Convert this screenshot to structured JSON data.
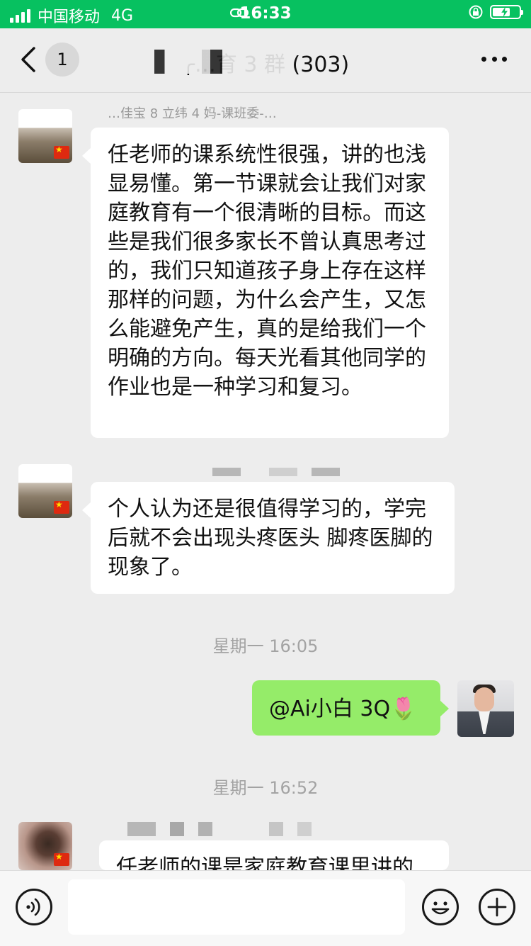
{
  "status_bar": {
    "carrier": "中国移动",
    "network": "4G",
    "time": "16:33"
  },
  "nav": {
    "unread_count": "1",
    "title": "╭…育 3 群 (303)"
  },
  "messages": [
    {
      "side": "left",
      "sender": "…佳宝 8 立纬 4 妈-课班委-…",
      "text": "任老师的课系统性很强，讲的也浅显易懂。第一节课就会让我们对家庭教育有一个很清晰的目标。而这些是我们很多家长不曾认真思考过的，我们只知道孩子身上存在这样那样的问题，为什么会产生，又怎么能避免产生，真的是给我们一个明确的方向。每天光看其他同学的作业也是一种学习和复习。"
    },
    {
      "side": "left",
      "sender": "",
      "text": "个人认为还是很值得学习的，学完后就不会出现头疼医头 脚疼医脚的现象了。"
    },
    {
      "side": "right",
      "time_before": "星期一 16:05",
      "text": "@Ai小白 3Q🌷"
    },
    {
      "side": "left",
      "time_before": "星期一 16:52",
      "sender": "",
      "text": "任老师的课是家庭教育课里讲的"
    }
  ],
  "input_bar": {
    "placeholder": ""
  },
  "icons": {
    "back": "chevron-left-icon",
    "more": "more-dots-icon",
    "voice": "voice-icon",
    "emoji": "emoji-icon",
    "plus": "plus-icon"
  },
  "colors": {
    "status_bar_bg": "#07c160",
    "self_bubble": "#95ec69",
    "other_bubble": "#ffffff",
    "chat_bg": "#ededed"
  }
}
